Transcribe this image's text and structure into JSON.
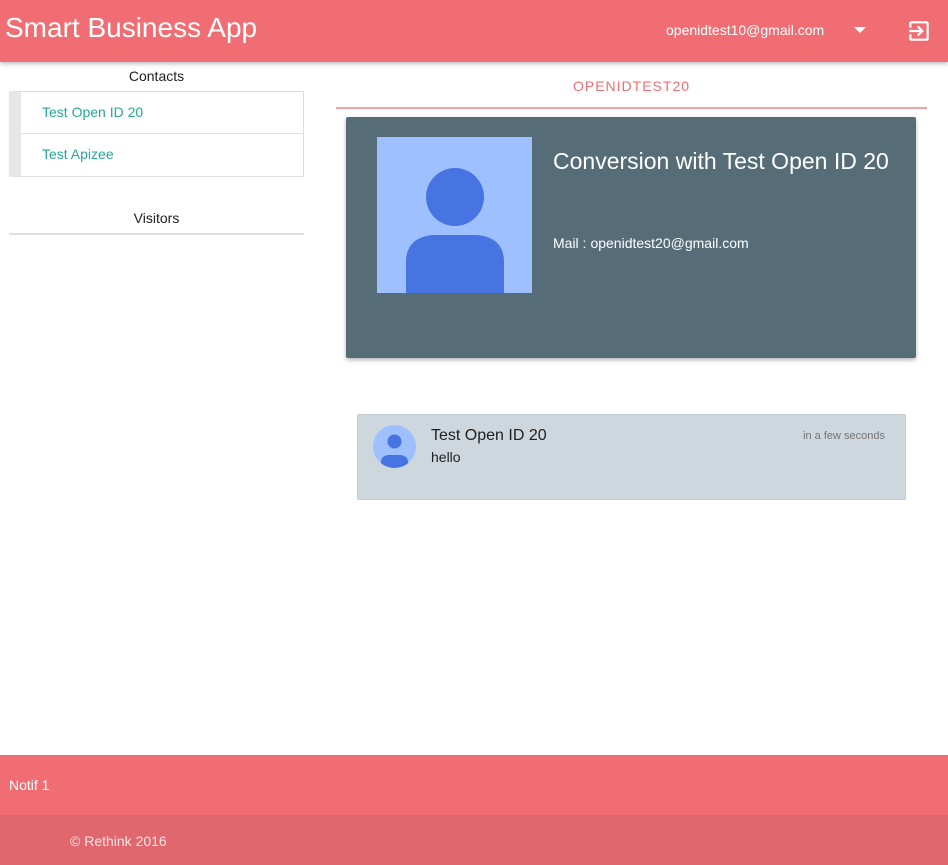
{
  "header": {
    "app_title": "Smart Business App",
    "user_email": "openidtest10@gmail.com",
    "dropdown_icon": "caret-down-icon",
    "logout_icon": "logout-icon"
  },
  "sidebar": {
    "contacts_heading": "Contacts",
    "contacts": [
      {
        "label": "Test Open ID 20"
      },
      {
        "label": "Test Apizee"
      }
    ],
    "visitors_heading": "Visitors"
  },
  "main": {
    "tab_label": "OPENIDTEST20",
    "profile": {
      "title": "Conversion with Test Open ID 20",
      "mail_label": "Mail :",
      "mail_value": "openidtest20@gmail.com",
      "avatar_icon": "person-icon"
    },
    "message": {
      "sender": "Test Open ID 20",
      "time": "in a few seconds",
      "text": "hello",
      "avatar_icon": "person-icon"
    }
  },
  "notification": {
    "text": "Notif 1"
  },
  "footer": {
    "copyright": "© Rethink 2016"
  },
  "colors": {
    "accent": "#f06d73",
    "footer": "#e0676d",
    "card": "#566d78",
    "link": "#26a69a",
    "avatar_bg": "#9fc0ff",
    "avatar_fg": "#4675e2"
  }
}
